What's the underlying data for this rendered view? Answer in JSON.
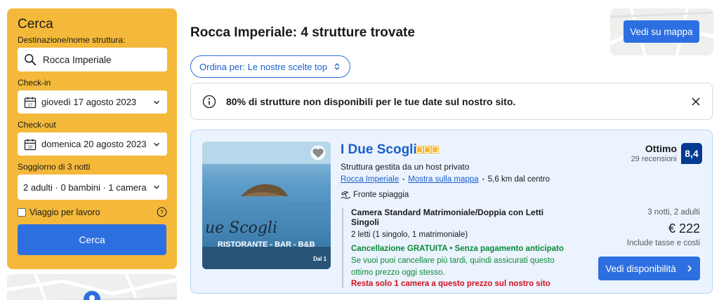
{
  "search": {
    "title": "Cerca",
    "destination_label": "Destinazione/nome struttura:",
    "destination_value": "Rocca Imperiale",
    "checkin_label": "Check-in",
    "checkin_value": "giovedì 17 agosto 2023",
    "checkin_day": "17",
    "checkout_label": "Check-out",
    "checkout_value": "domenica 20 agosto 2023",
    "checkout_day": "20",
    "stay_label": "Soggiorno di 3 notti",
    "guests_value": "2 adulti · 0 bambini · 1 camera",
    "work_travel_label": "Viaggio per lavoro",
    "search_button": "Cerca"
  },
  "header": {
    "title": "Rocca Imperiale: 4 strutture trovate",
    "map_button": "Vedi su mappa",
    "sort_label": "Ordina per: Le nostre scelte top"
  },
  "alert": {
    "message": "80% di strutture non disponibili per le tue date sul nostro sito."
  },
  "property": {
    "name": "I Due Scogli",
    "star_count": 3,
    "host_text": "Struttura gestita da un host privato",
    "location_link": "Rocca Imperiale",
    "map_link": "Mostra sulla mappa",
    "distance": "5,6 km dal centro",
    "beachfront": "Fronte spiaggia",
    "photo_sign_text": "ue Scogli",
    "photo_sign_subtext": "RISTORANTE - BAR - B&B",
    "photo_sign_corner": "Dal 1",
    "rating_word": "Ottimo",
    "reviews": "29 recensioni",
    "score": "8,4",
    "room_name": "Camera Standard Matrimoniale/Doppia con Letti Singoli",
    "beds": "2 letti (1 singolo, 1 matrimoniale)",
    "free_cancel": "Cancellazione GRATUITA • Senza pagamento anticipato",
    "cancel_note": "Se vuoi puoi cancellare più tardi, quindi assicurati questo ottimo prezzo oggi stesso.",
    "scarcity": "Resta solo 1 camera a questo prezzo sul nostro sito",
    "stay_info": "3 notti, 2 adulti",
    "price": "€ 222",
    "taxes": "Include tasse e costi",
    "availability_button": "Vedi disponibilità"
  },
  "colors": {
    "brand_blue": "#2d6fe0",
    "search_panel_yellow": "#f4b93a",
    "score_navy": "#053a91",
    "positive_green": "#0b8a38",
    "urgent_red": "#d4111e"
  }
}
